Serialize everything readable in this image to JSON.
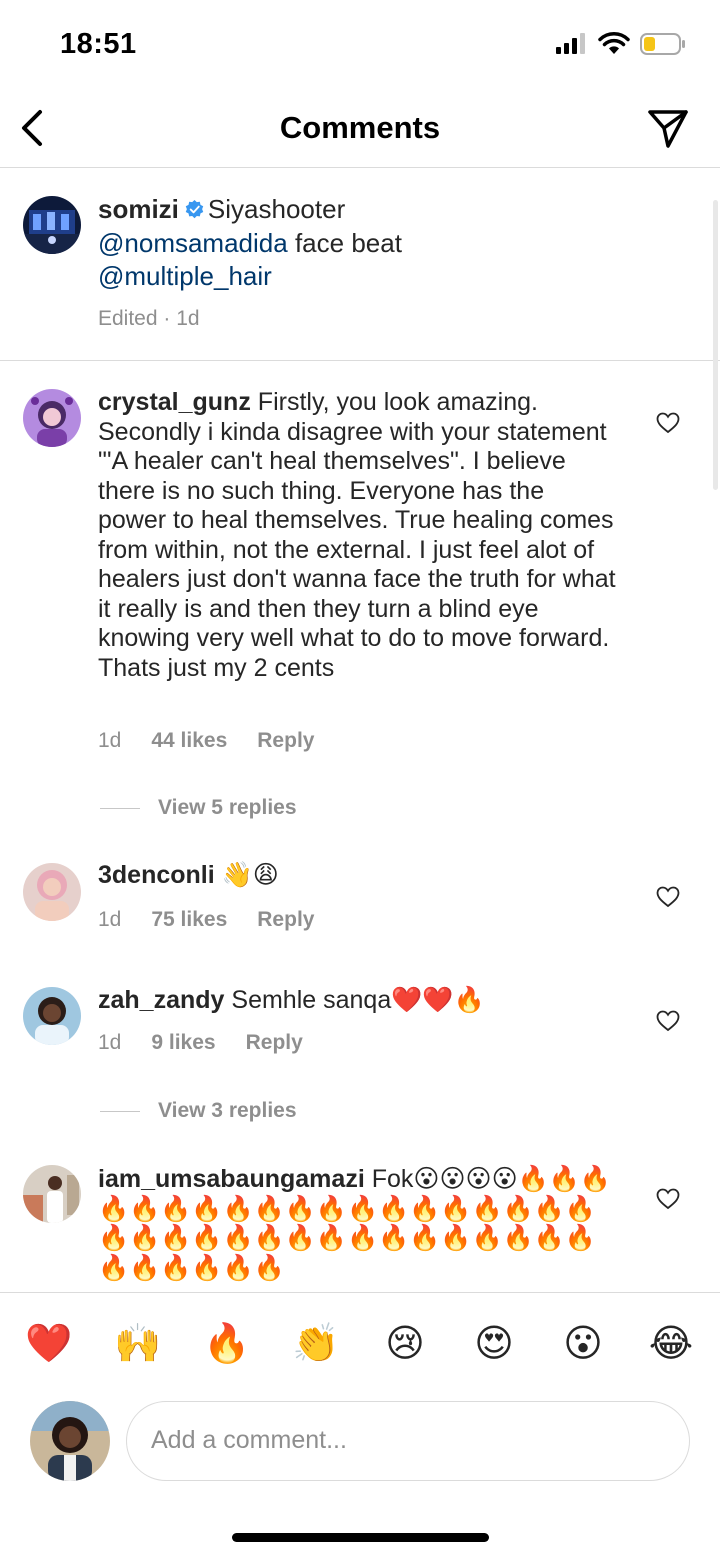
{
  "status_bar": {
    "time": "18:51"
  },
  "nav": {
    "title": "Comments"
  },
  "caption": {
    "username": "somizi",
    "text": "Siyashooter",
    "mention_1": "@nomsamadida",
    "text_2": "face beat",
    "mention_2": "@multiple_hair",
    "meta": "Edited · 1d"
  },
  "comments": [
    {
      "username": "crystal_gunz",
      "text": "Firstly, you look amazing. Secondly i kinda disagree with your statement \"'A healer can't heal themselves\". I believe there is no such thing. Everyone has the power to heal themselves. True healing comes from within, not the external. I just feel alot of healers just don't wanna face the truth for what it really is and then they turn a blind eye knowing very well what to do to move forward. Thats just my 2 cents",
      "time": "1d",
      "likes": "44 likes",
      "reply": "Reply",
      "view_replies": "View 5 replies"
    },
    {
      "username": "3denconli",
      "text": "👋😩",
      "time": "1d",
      "likes": "75 likes",
      "reply": "Reply"
    },
    {
      "username": "zah_zandy",
      "text": "Semhle sanqa❤️❤️🔥",
      "time": "1d",
      "likes": "9 likes",
      "reply": "Reply",
      "view_replies": "View 3 replies"
    },
    {
      "username": "iam_umsabaungamazi",
      "text": "Fok😮😮😮😮🔥🔥🔥🔥🔥🔥🔥🔥🔥🔥🔥🔥🔥🔥🔥🔥🔥🔥🔥🔥🔥🔥🔥🔥🔥🔥🔥🔥🔥🔥🔥🔥🔥🔥🔥🔥🔥🔥🔥🔥🔥"
    }
  ],
  "quick_reactions": [
    "❤️",
    "🙌",
    "🔥",
    "👏",
    "😢",
    "😍",
    "😮",
    "😂"
  ],
  "composer": {
    "placeholder": "Add a comment..."
  },
  "colors": {
    "mention": "#00376b",
    "secondary_text": "#8e8e8e",
    "divider": "#dbdbdb"
  }
}
